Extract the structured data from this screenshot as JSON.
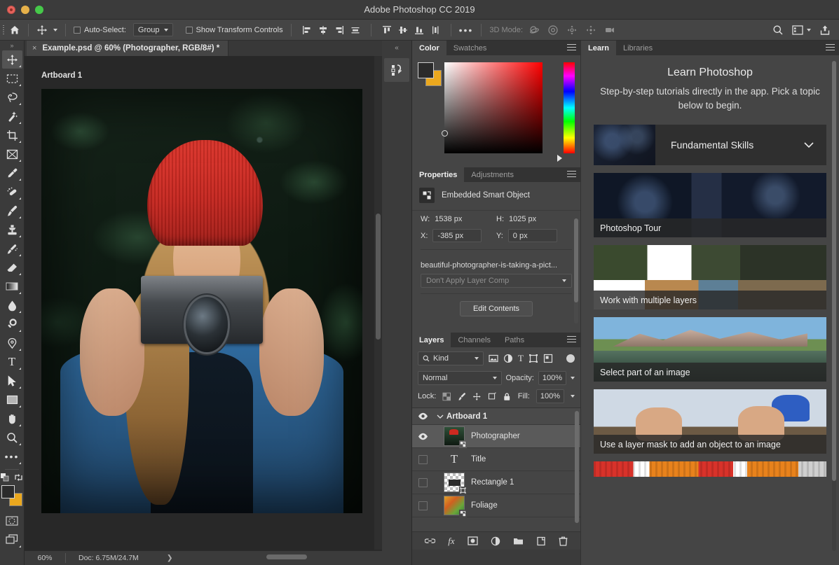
{
  "window": {
    "title": "Adobe Photoshop CC 2019",
    "traffic_lights": [
      "close",
      "minimize",
      "maximize"
    ]
  },
  "options_bar": {
    "home_icon": "home-icon",
    "tool_icon": "move-tool-icon",
    "auto_select_label": "Auto-Select:",
    "auto_select_value": "Group",
    "show_transform_label": "Show Transform Controls",
    "align_icons": [
      "align-left-edges-icon",
      "align-horizontal-centers-icon",
      "align-right-edges-icon",
      "distribute-horizontal-icon"
    ],
    "align_icons2": [
      "align-top-edges-icon",
      "align-vertical-centers-icon",
      "align-bottom-edges-icon",
      "distribute-vertical-icon"
    ],
    "more_label": "•••",
    "mode_3d_label": "3D Mode:",
    "mode_3d_icons": [
      "orbit-3d-icon",
      "roll-3d-icon",
      "pan-3d-icon",
      "slide-3d-icon",
      "camera-3d-icon"
    ],
    "search_icon": "search-icon",
    "workspace_icon": "workspace-switcher-icon",
    "share_icon": "share-icon"
  },
  "toolbox": {
    "collapse_label": "»",
    "tools": [
      {
        "name": "move-tool",
        "selected": true
      },
      {
        "name": "rectangular-marquee-tool",
        "selected": false
      },
      {
        "name": "lasso-tool",
        "selected": false
      },
      {
        "name": "magic-wand-tool",
        "selected": false
      },
      {
        "name": "crop-tool",
        "selected": false
      },
      {
        "name": "frame-tool",
        "selected": false
      },
      {
        "name": "eyedropper-tool",
        "selected": false
      },
      {
        "name": "spot-healing-brush-tool",
        "selected": false
      },
      {
        "name": "brush-tool",
        "selected": false
      },
      {
        "name": "clone-stamp-tool",
        "selected": false
      },
      {
        "name": "history-brush-tool",
        "selected": false
      },
      {
        "name": "eraser-tool",
        "selected": false
      },
      {
        "name": "gradient-tool",
        "selected": false
      },
      {
        "name": "blur-tool",
        "selected": false
      },
      {
        "name": "dodge-tool",
        "selected": false
      },
      {
        "name": "pen-tool",
        "selected": false
      },
      {
        "name": "type-tool",
        "selected": false
      },
      {
        "name": "path-selection-tool",
        "selected": false
      },
      {
        "name": "rectangle-tool",
        "selected": false
      },
      {
        "name": "hand-tool",
        "selected": false
      },
      {
        "name": "zoom-tool",
        "selected": false
      },
      {
        "name": "edit-toolbar-tool",
        "selected": false
      }
    ],
    "foreground_color": "#2b2b2b",
    "background_color": "#eba81e",
    "quick_mask_icon": "quick-mask-icon",
    "screen_mode_icon": "screen-mode-icon"
  },
  "document": {
    "tab_label": "Example.psd @ 60% (Photographer, RGB/8#) *",
    "tab_close": "×",
    "artboard_label": "Artboard 1",
    "status": {
      "zoom": "60%",
      "doc_size": "Doc: 6.75M/24.7M",
      "arrow": "❯"
    }
  },
  "mini_dock": {
    "collapse_label": "«",
    "button_icon": "history-panel-icon"
  },
  "color_panel": {
    "tabs": [
      {
        "label": "Color",
        "active": true
      },
      {
        "label": "Swatches",
        "active": false
      }
    ],
    "menu_icon": "panel-menu-icon",
    "foreground_color": "#2b2b2b",
    "background_color": "#eba81e"
  },
  "properties_panel": {
    "tabs": [
      {
        "label": "Properties",
        "active": true
      },
      {
        "label": "Adjustments",
        "active": false
      }
    ],
    "menu_icon": "panel-menu-icon",
    "object_type": "Embedded Smart Object",
    "object_icon": "smart-object-icon",
    "w_label": "W:",
    "w_value": "1538 px",
    "h_label": "H:",
    "h_value": "1025 px",
    "x_label": "X:",
    "x_value": "-385 px",
    "y_label": "Y:",
    "y_value": "0 px",
    "filename": "beautiful-photographer-is-taking-a-pict...",
    "layer_comp": "Don't Apply Layer Comp",
    "edit_contents_label": "Edit Contents"
  },
  "layers_panel": {
    "tabs": [
      {
        "label": "Layers",
        "active": true
      },
      {
        "label": "Channels",
        "active": false
      },
      {
        "label": "Paths",
        "active": false
      }
    ],
    "menu_icon": "panel-menu-icon",
    "kind_label": "Kind",
    "filter_icons": [
      "filter-pixel-icon",
      "filter-adjustment-icon",
      "filter-type-icon",
      "filter-shape-icon",
      "filter-smart-object-icon"
    ],
    "filter_toggle_icon": "filter-toggle-icon",
    "blend_mode": "Normal",
    "opacity_label": "Opacity:",
    "opacity_value": "100%",
    "lock_label": "Lock:",
    "lock_icons": [
      "lock-transparent-pixels-icon",
      "lock-image-pixels-icon",
      "lock-position-icon",
      "lock-artboard-nesting-icon",
      "lock-all-icon"
    ],
    "fill_label": "Fill:",
    "fill_value": "100%",
    "layers": [
      {
        "name": "Artboard 1",
        "type": "group",
        "visible": true,
        "selected": false,
        "expanded": true
      },
      {
        "name": "Photographer",
        "type": "smart-object",
        "visible": true,
        "selected": true
      },
      {
        "name": "Title",
        "type": "text",
        "visible": false,
        "selected": false
      },
      {
        "name": "Rectangle 1",
        "type": "shape",
        "visible": false,
        "selected": false
      },
      {
        "name": "Foliage",
        "type": "smart-object",
        "visible": false,
        "selected": false
      }
    ],
    "footer_icons": [
      "link-layers-icon",
      "layer-style-fx-icon",
      "add-layer-mask-icon",
      "new-adjustment-layer-icon",
      "new-group-icon",
      "new-layer-icon",
      "delete-layer-icon"
    ]
  },
  "learn_panel": {
    "tabs": [
      {
        "label": "Learn",
        "active": true
      },
      {
        "label": "Libraries",
        "active": false
      }
    ],
    "menu_icon": "panel-menu-icon",
    "title": "Learn Photoshop",
    "subtitle": "Step-by-step tutorials directly in the app. Pick a topic below to begin.",
    "topic": {
      "label": "Fundamental Skills",
      "chevron_icon": "chevron-down-icon"
    },
    "cards": [
      {
        "label": "Photoshop Tour",
        "image": "img-tour"
      },
      {
        "label": "Work with multiple layers",
        "image": "img-layers"
      },
      {
        "label": "Select part of an image",
        "image": "img-mountain"
      },
      {
        "label": "Use a layer mask to add an object to an image",
        "image": "img-hands"
      },
      {
        "label": "",
        "image": "img-fans"
      }
    ]
  },
  "colors": {
    "chrome": "#3b3b3b",
    "panel": "#454545",
    "tabstrip": "#333333",
    "canvas": "#282828",
    "accent_orange": "#eba81e",
    "selected_layer": "#5a5a5a"
  }
}
